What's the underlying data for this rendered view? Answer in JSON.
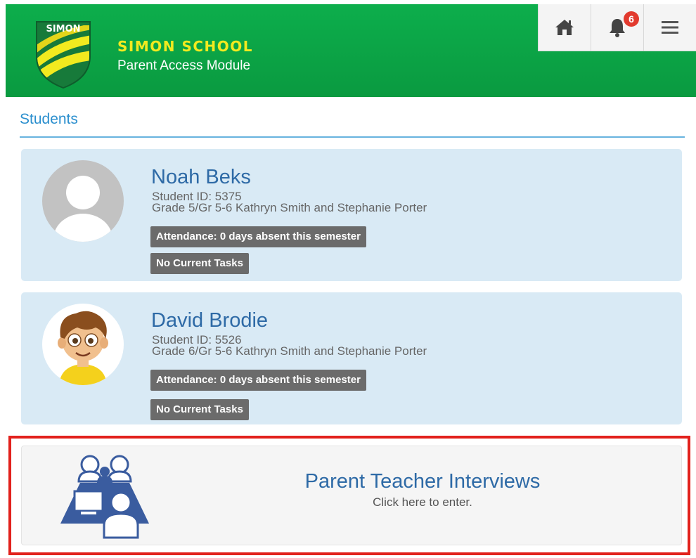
{
  "header": {
    "logo_text": "SIMON",
    "school_name": "SIMON SCHOOL",
    "module_name": "Parent Access Module",
    "notification_count": "6",
    "icons": [
      "home-icon",
      "bell-icon",
      "menu-icon"
    ],
    "colors": {
      "header_green": "#0a9a40",
      "brand_yellow": "#f2ea1f",
      "badge_red": "#e23a2e"
    }
  },
  "main": {
    "section_title": "Students",
    "students": [
      {
        "name": "Noah Beks",
        "student_id": "Student ID: 5375",
        "grade": "Grade 5/Gr 5-6 Kathryn Smith and Stephanie Porter",
        "attendance": "Attendance: 0 days absent this semester",
        "tasks": "No Current Tasks",
        "avatar": "placeholder-avatar-icon"
      },
      {
        "name": "David Brodie",
        "student_id": "Student ID: 5526",
        "grade": "Grade 6/Gr 5-6 Kathryn Smith and Stephanie Porter",
        "attendance": "Attendance: 0 days absent this semester",
        "tasks": "No Current Tasks",
        "avatar": "cartoon-boy-avatar"
      }
    ],
    "interviews": {
      "title": "Parent Teacher Interviews",
      "subtitle": "Click here to enter.",
      "icon": "meeting-icon"
    }
  }
}
